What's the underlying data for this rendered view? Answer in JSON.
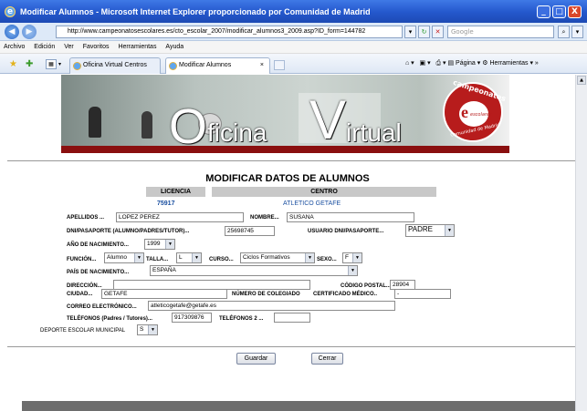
{
  "window": {
    "title": "Modificar Alumnos - Microsoft Internet Explorer proporcionado por Comunidad de Madrid",
    "minimize": "_",
    "maximize": "□",
    "close": "X"
  },
  "address": {
    "url": "http://www.campeonatosescolares.es/cto_escolar_2007/modificar_alumnos3_2009.asp?ID_form=144782",
    "search_placeholder": "Google"
  },
  "menu": [
    "Archivo",
    "Edición",
    "Ver",
    "Favoritos",
    "Herramientas",
    "Ayuda"
  ],
  "tabs": [
    {
      "label": "Oficina Virtual Centros"
    },
    {
      "label": "Modificar Alumnos",
      "close": "×"
    }
  ],
  "toolbar": {
    "page": "Página",
    "tools": "Herramientas"
  },
  "banner": {
    "text_main_1": "O",
    "text_main_2": "ficina",
    "text_main_3": "V",
    "text_main_4": "irtual",
    "logo_top": "campeonatos",
    "logo_mid": "escolares",
    "logo_bottom": "Comunidad de Madrid"
  },
  "form": {
    "title": "MODIFICAR DATOS DE ALUMNOS",
    "col_licencia": "LICENCIA",
    "col_centro": "CENTRO",
    "licencia": "75917",
    "centro": "ATLETICO GETAFE",
    "apellidos_label": "APELLIDOS ...",
    "apellidos": "LOPEZ PEREZ",
    "nombre_label": "NOMBRE...",
    "nombre": "SUSANA",
    "dni_label": "DNI/PASAPORTE (ALUMNO/PADRES/TUTOR)...",
    "dni": "25698745",
    "usuario_label": "USUARIO DNI/PASAPORTE...",
    "usuario": "PADRE",
    "anio_label": "AÑO DE NACIMIENTO...",
    "anio": "1999",
    "funcion_label": "FUNCIÓN...",
    "funcion": "Alumno",
    "talla_label": "TALLA...",
    "talla": "L",
    "curso_label": "CURSO...",
    "curso": "Ciclos Formativos",
    "sexo_label": "SEXO...",
    "sexo": "F",
    "pais_label": "PAÍS DE NACIMIENTO...",
    "pais": "ESPAÑA",
    "direccion_label": "DIRECCIÓN...",
    "direccion": "",
    "cp_label": "CÓDIGO POSTAL...",
    "cp": "28904",
    "ciudad_label": "CIUDAD...",
    "ciudad": "GETAFE",
    "colegiado_label": "NÚMERO DE COLEGIADO",
    "certificado_label": "CERTIFICADO MÉDICO..",
    "certificado": "-",
    "correo_label": "CORREO ELECTRÓNICO...",
    "correo": "atleticogetafe@getafe.es",
    "tel1_label": "TELÉFONOS (Padres / Tutores)...",
    "tel1": "917309876",
    "tel2_label": "TELÉFONOS 2 ...",
    "tel2": "",
    "deporte_label": "DEPORTE ESCOLAR MUNICIPAL",
    "deporte": "S",
    "save": "Guardar",
    "close": "Cerrar"
  },
  "colors": {
    "titlebar": "#2457cc",
    "banner_accent": "#8a0f0f",
    "link": "#1a4fa0"
  }
}
